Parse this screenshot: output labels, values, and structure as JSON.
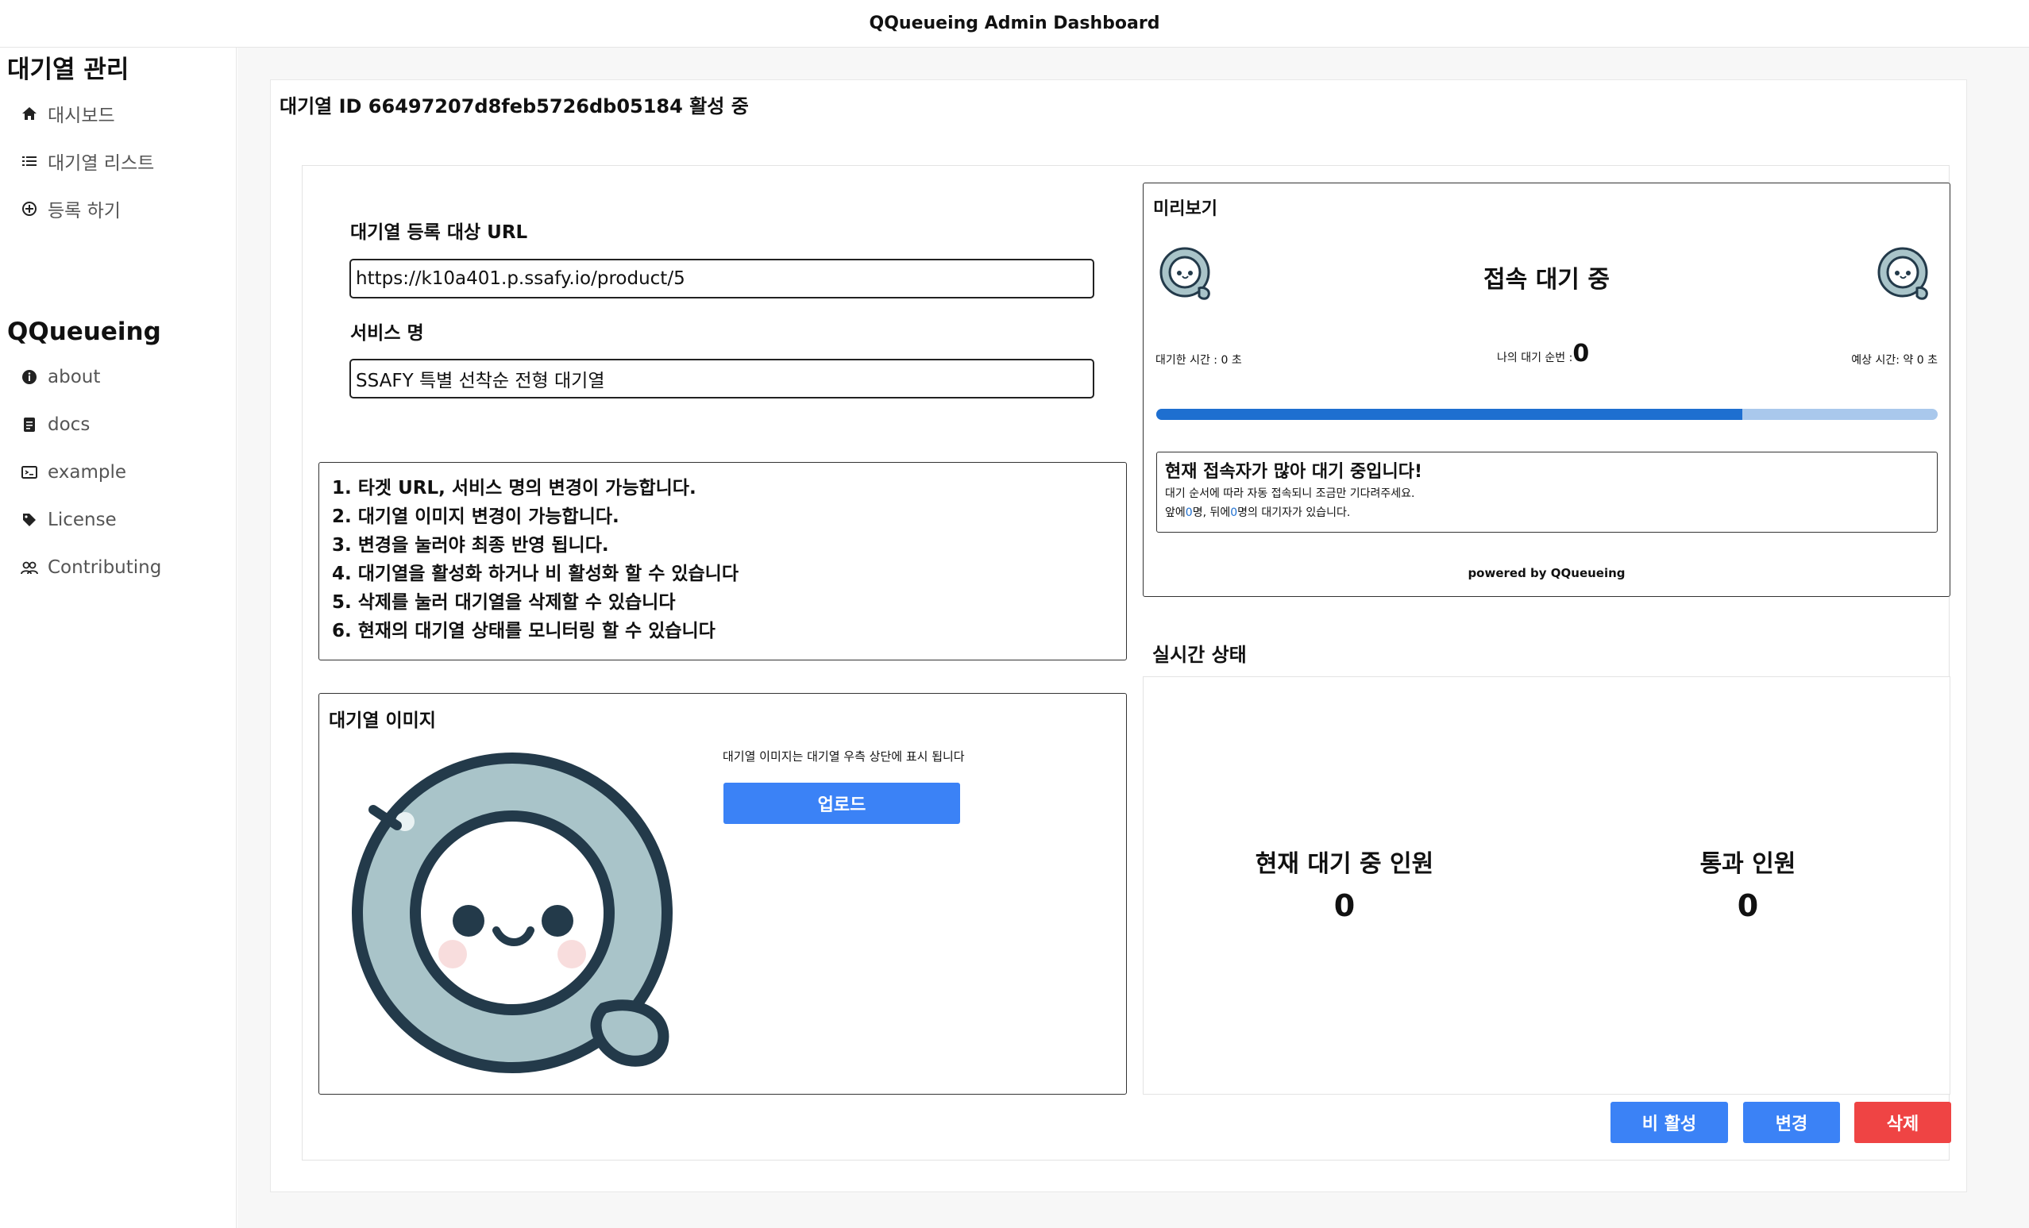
{
  "app": {
    "title": "QQueueing Admin Dashboard"
  },
  "sidebar": {
    "section1_title": "대기열 관리",
    "items1": [
      {
        "label": "대시보드",
        "icon": "home-icon"
      },
      {
        "label": "대기열 리스트",
        "icon": "list-icon"
      },
      {
        "label": "등록 하기",
        "icon": "plus-circle-icon"
      }
    ],
    "section2_title": "QQueueing",
    "items2": [
      {
        "label": "about",
        "icon": "info-icon"
      },
      {
        "label": "docs",
        "icon": "document-icon"
      },
      {
        "label": "example",
        "icon": "terminal-icon"
      },
      {
        "label": "License",
        "icon": "tag-icon"
      },
      {
        "label": "Contributing",
        "icon": "users-icon"
      }
    ]
  },
  "queue": {
    "id_text": "대기열 ID 66497207d8feb5726db05184 활성 중"
  },
  "form": {
    "url_label": "대기열 등록 대상 URL",
    "url_value": "https://k10a401.p.ssafy.io/product/5",
    "service_label": "서비스 명",
    "service_value": "SSAFY 특별 선착순 전형 대기열"
  },
  "info": {
    "lines": [
      "1. 타겟 URL, 서비스 명의 변경이 가능합니다.",
      "2. 대기열 이미지 변경이 가능합니다.",
      "3. 변경을 눌러야 최종 반영 됩니다.",
      "4. 대기열을 활성화 하거나 비 활성화 할 수 있습니다",
      "5. 삭제를 눌러 대기열을 삭제할 수 있습니다",
      "6. 현재의 대기열 상태를 모니터링 할 수 있습니다"
    ]
  },
  "image_section": {
    "title": "대기열 이미지",
    "hint": "대기열 이미지는 대기열 우측 상단에 표시 됩니다",
    "upload_label": "업로드"
  },
  "preview": {
    "title": "미리보기",
    "wait_title": "접속 대기 중",
    "waited_time": "대기한 시간 : 0 초",
    "my_order_label": "나의 대기 순번 :",
    "my_order_value": "0",
    "expected_time": "예상 시간: 약 0 초",
    "progress_percent": 75,
    "notice_title": "현재 접속자가 많아 대기 중입니다!",
    "notice_line1": "대기 순서에 따라 자동 접속되니 조금만 기다려주세요.",
    "notice_front_prefix": "앞에",
    "notice_front_count": "0",
    "notice_front_suffix": "명, 뒤에",
    "notice_back_count": "0",
    "notice_back_suffix": "명의 대기자가 있습니다.",
    "powered": "powered by QQueueing"
  },
  "realtime": {
    "title": "실시간 상태",
    "waiting_label": "현재 대기 중 인원",
    "waiting_value": "0",
    "passed_label": "통과 인원",
    "passed_value": "0"
  },
  "actions": {
    "deactivate": "비 활성",
    "modify": "변경",
    "delete": "삭제"
  },
  "colors": {
    "primary": "#3b82f6",
    "danger": "#ef4444",
    "progress_fill": "#1e6fd0",
    "progress_track": "#a9c8ec"
  }
}
